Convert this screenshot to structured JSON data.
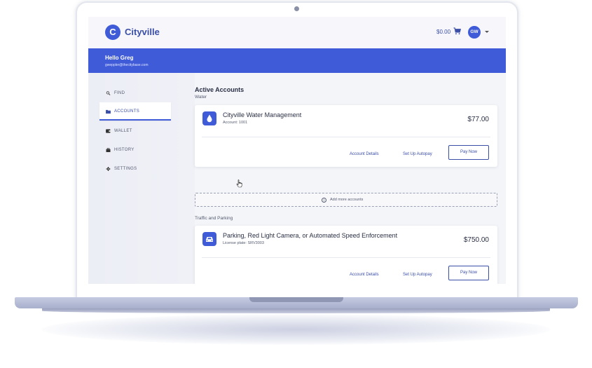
{
  "app": {
    "name": "Cityville",
    "logo_letter": "C",
    "brand_color": "#3f5bd8"
  },
  "header": {
    "cart_amount": "$0.00",
    "cart_icon": "cart-icon",
    "avatar_initials": "GW"
  },
  "banner": {
    "greeting": "Hello Greg",
    "email": "gweppler@thecitybase.com"
  },
  "sidebar": {
    "items": [
      {
        "label": "FIND",
        "icon": "search-icon",
        "active": false
      },
      {
        "label": "ACCOUNTS",
        "icon": "folder-icon",
        "active": true
      },
      {
        "label": "WALLET",
        "icon": "wallet-icon",
        "active": false
      },
      {
        "label": "HISTORY",
        "icon": "history-icon",
        "active": false
      },
      {
        "label": "SETTINGS",
        "icon": "gear-icon",
        "active": false
      }
    ]
  },
  "main": {
    "title": "Active Accounts",
    "sections": [
      {
        "heading": "Water",
        "account": {
          "icon": "water-drop-icon",
          "name": "Cityville Water Management",
          "detail": "Account: 1001",
          "amount": "$77.00",
          "details_label": "Account Details",
          "autopay_label": "Set Up Autopay",
          "pay_label": "Pay Now"
        }
      },
      {
        "heading": "Traffic and Parking",
        "account": {
          "icon": "car-icon",
          "name": "Parking, Red Light Camera, or Automated Speed Enforcement",
          "detail": "License plate: SRV3003",
          "amount": "$750.00",
          "details_label": "Account Details",
          "autopay_label": "Set Up Autopay",
          "pay_label": "Pay Now"
        }
      }
    ],
    "add_more_label": "Add more accounts"
  }
}
